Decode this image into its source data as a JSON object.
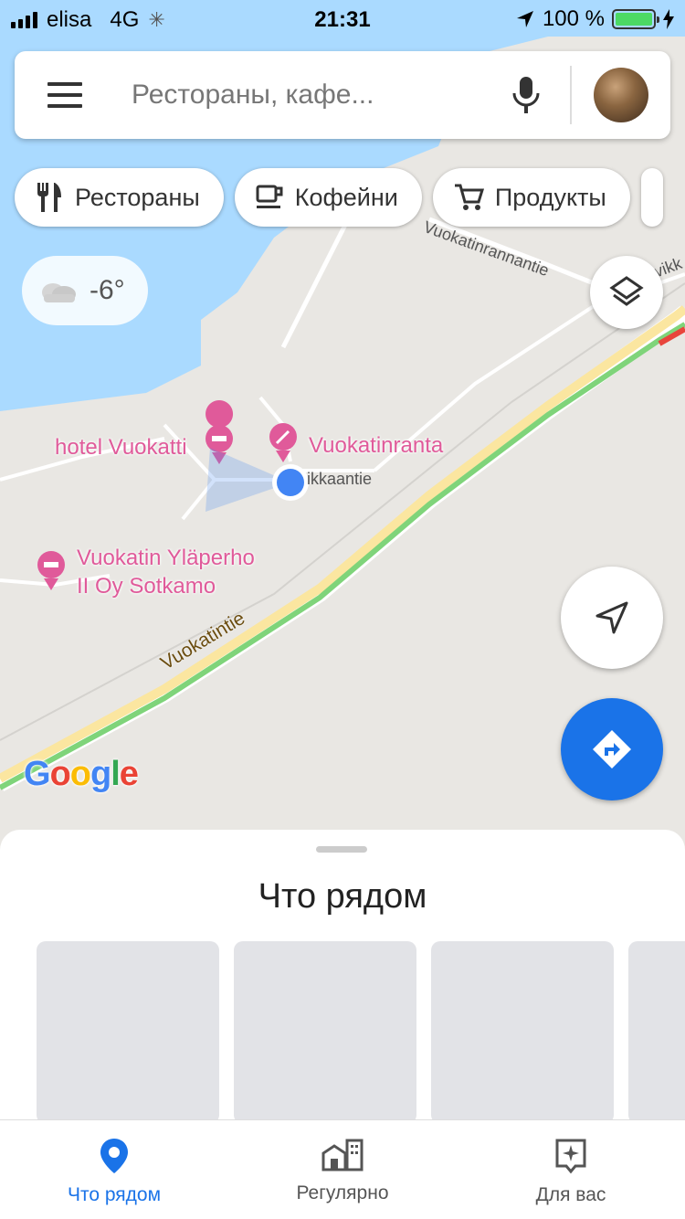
{
  "status_bar": {
    "carrier": "elisa",
    "network": "4G",
    "time": "21:31",
    "battery": "100 %"
  },
  "search": {
    "placeholder": "Рестораны, кафе..."
  },
  "chips": [
    {
      "label": "Рестораны",
      "icon": "fork-knife-icon"
    },
    {
      "label": "Кофейни",
      "icon": "coffee-cup-icon"
    },
    {
      "label": "Продукты",
      "icon": "shopping-cart-icon"
    }
  ],
  "weather": {
    "temperature": "-6°",
    "icon": "cloudy-icon"
  },
  "map": {
    "pois": [
      {
        "name": "hotel Vuokatti",
        "icon": "hotel-icon"
      },
      {
        "name": "Vuokatinranta",
        "icon": "beach-icon"
      },
      {
        "name_line1": "Vuokatin Yläperho",
        "name_line2": "II Oy Sotkamo",
        "icon": "hotel-icon"
      }
    ],
    "roads": {
      "main": "Vuokatintie",
      "north": "Vuokatinrannantie",
      "near": "ikkaantie",
      "northeast": "uvikk"
    },
    "logo": "Google",
    "colors": {
      "water": "#aadaff",
      "land": "#e9e7e3",
      "traffic_green": "#7fd47a",
      "traffic_red": "#e8453c",
      "road_yellow": "#fbe6a0",
      "poi_pink": "#e05a9a",
      "accent_blue": "#1a73e8"
    }
  },
  "sheet": {
    "title": "Что рядом"
  },
  "tabs": [
    {
      "label": "Что рядом",
      "icon": "pin-icon",
      "active": true
    },
    {
      "label": "Регулярно",
      "icon": "commute-icon",
      "active": false
    },
    {
      "label": "Для вас",
      "icon": "sparkle-icon",
      "active": false
    }
  ]
}
